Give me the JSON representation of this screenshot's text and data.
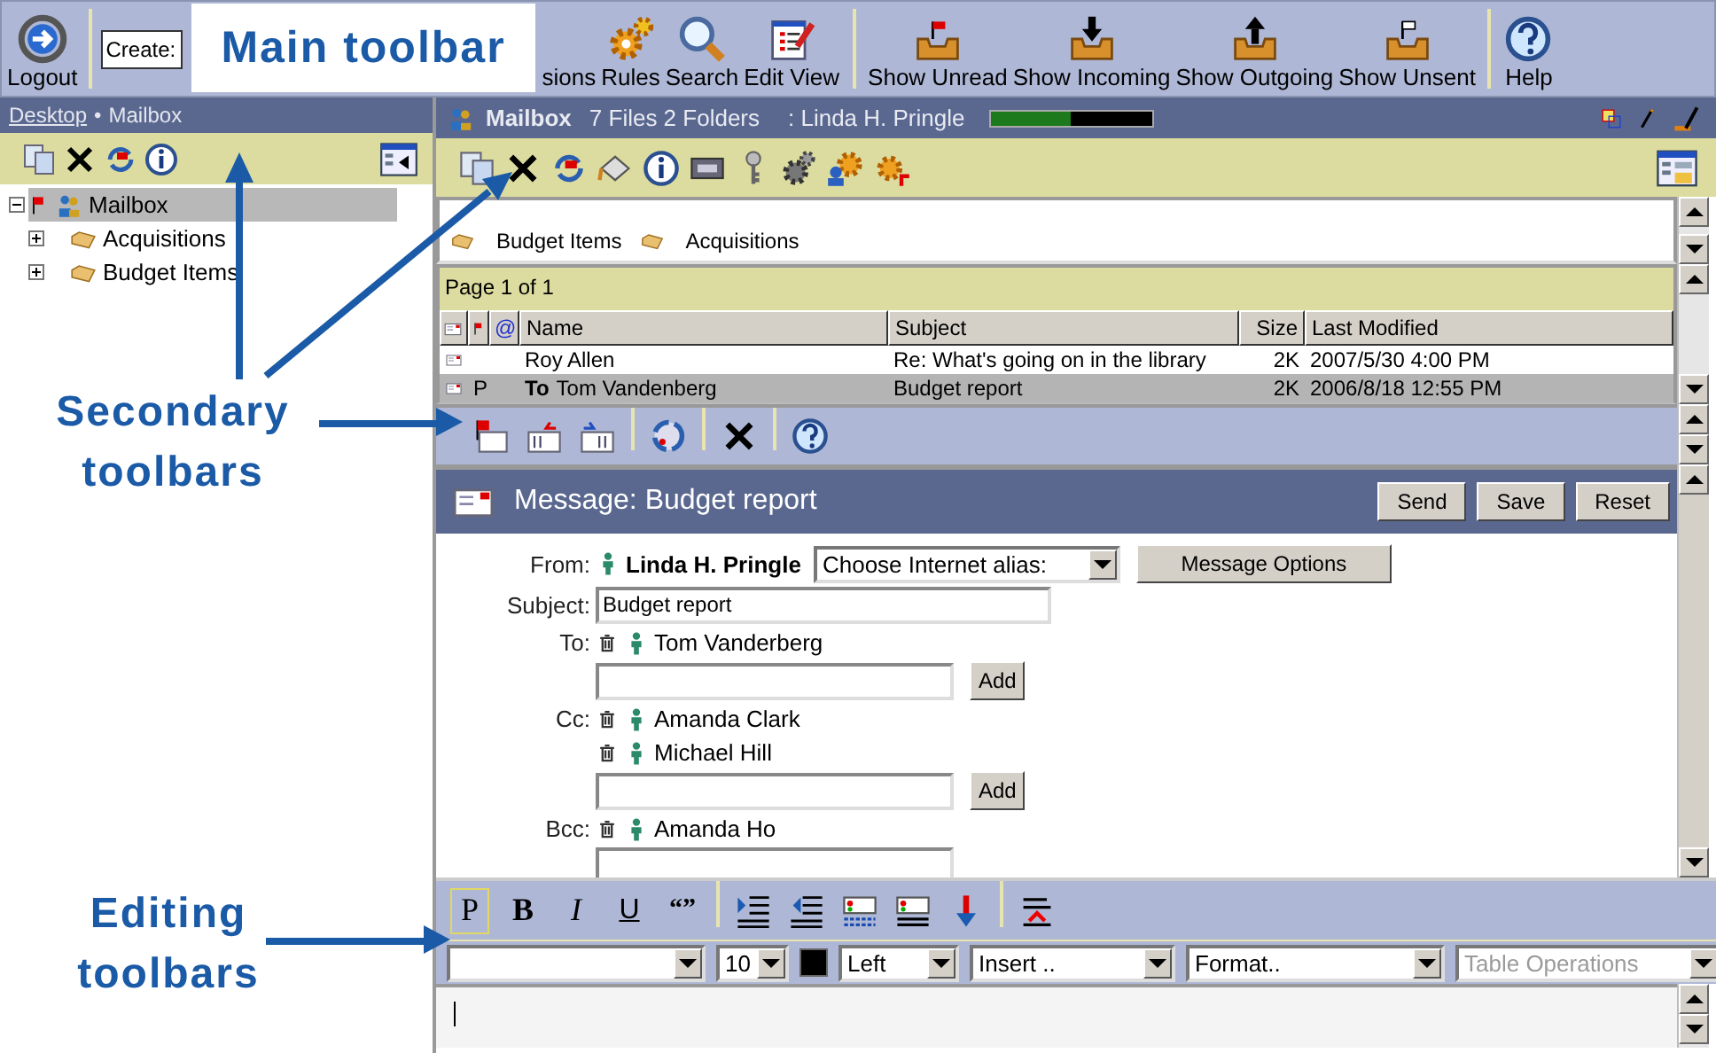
{
  "main_toolbar": {
    "logout": "Logout",
    "create_field": {
      "value": "Create:"
    },
    "buttons": [
      {
        "label": "sions"
      },
      {
        "label": "Rules"
      },
      {
        "label": "Search"
      },
      {
        "label": "Edit View"
      },
      {
        "label": "Show Unread"
      },
      {
        "label": "Show Incoming"
      },
      {
        "label": "Show Outgoing"
      },
      {
        "label": "Show Unsent"
      },
      {
        "label": "Help"
      }
    ]
  },
  "sidebar": {
    "breadcrumb": {
      "link": "Desktop",
      "separator": "•",
      "current": "Mailbox"
    },
    "tree": [
      {
        "label": "Mailbox",
        "expanded": true,
        "selected": true,
        "flagged": true,
        "children": [
          {
            "label": "Acquisitions",
            "expanded": false,
            "selected": false,
            "flagged": false
          },
          {
            "label": "Budget Items",
            "expanded": false,
            "selected": false,
            "flagged": false
          }
        ]
      }
    ]
  },
  "mailbox_header": {
    "title": "Mailbox",
    "counts": "7 Files 2 Folders",
    "owner": ": Linda H. Pringle",
    "quota": {
      "level": 0.49
    }
  },
  "folders": [
    {
      "label": "Budget Items"
    },
    {
      "label": "Acquisitions"
    }
  ],
  "pager": "Page 1 of 1",
  "table": {
    "attach_column": "@",
    "columns": [
      "Name",
      "Subject",
      "Size",
      "Last Modified"
    ],
    "rows": [
      {
        "name": "Roy Allen",
        "subject": "Re: What's going on in the library",
        "size": "2K",
        "modified": "2007/5/30 4:00 PM",
        "selected": false
      },
      {
        "mark": "P",
        "prefix": "To",
        "name": "Tom Vandenberg",
        "subject": "Budget report",
        "size": "2K",
        "modified": "2006/8/18 12:55 PM",
        "selected": true
      }
    ]
  },
  "message": {
    "title": "Message: Budget report",
    "actions": [
      "Send",
      "Save",
      "Reset"
    ],
    "from_label": "From:",
    "from": "Linda H. Pringle",
    "alias": "Choose Internet alias:",
    "options_button": "Message Options",
    "subject_label": "Subject:",
    "subject": "Budget report",
    "recipients": [
      {
        "label": "To:",
        "people": [
          "Tom Vanderberg"
        ],
        "add": "Add"
      },
      {
        "label": "Cc:",
        "people": [
          "Amanda Clark",
          "Michael Hill"
        ],
        "add": "Add"
      },
      {
        "label": "Bcc:",
        "people": [
          "Amanda Ho"
        ]
      }
    ]
  },
  "editor": {
    "format_buttons": [
      {
        "label": "P",
        "selected": true
      },
      {
        "label": "B",
        "selected": false
      },
      {
        "label": "I",
        "selected": false
      },
      {
        "label": "U",
        "selected": false
      },
      {
        "label": "“”",
        "selected": false
      }
    ],
    "font_size": "10",
    "color": "#000000",
    "align": "Left",
    "insert": "Insert ..",
    "format": "Format..",
    "table_ops": {
      "label": "Table Operations",
      "disabled": true
    }
  },
  "annotations": [
    {
      "text": "Main toolbar"
    },
    {
      "text": "Secondary toolbars"
    },
    {
      "text": "Editing toolbars"
    }
  ]
}
